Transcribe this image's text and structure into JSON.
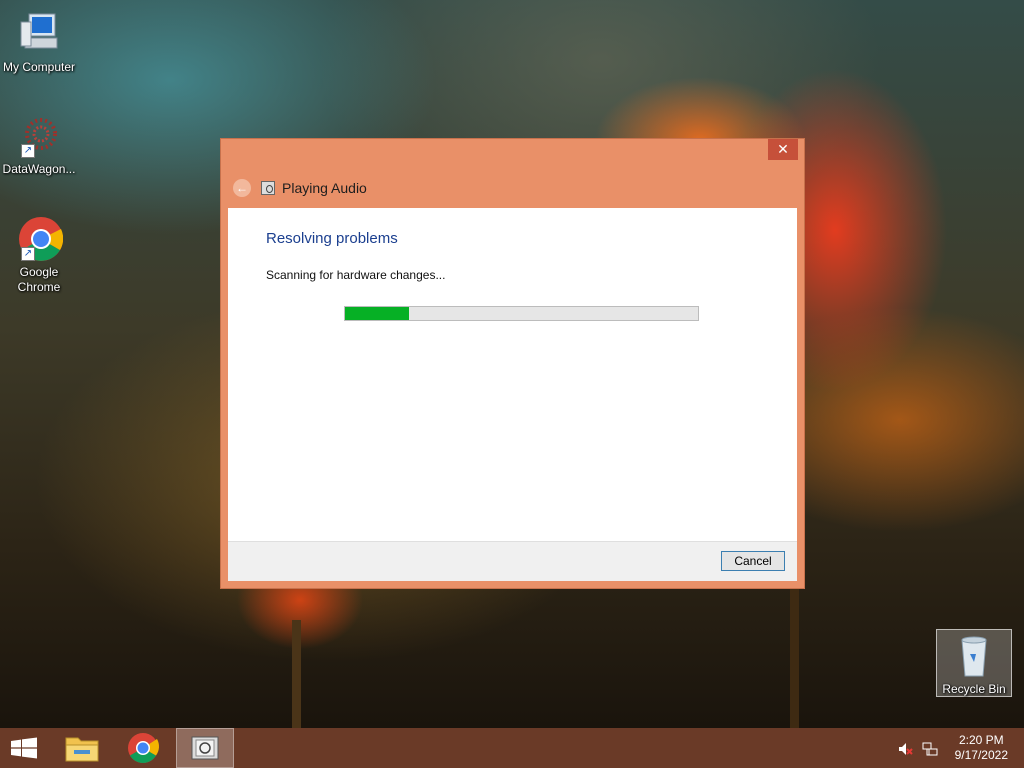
{
  "desktop": {
    "icons": [
      {
        "label": "My Computer",
        "icon": "my-computer-icon"
      },
      {
        "label": "DataWagon...",
        "icon": "datawagon-icon"
      },
      {
        "label": "Google Chrome",
        "icon": "chrome-icon"
      },
      {
        "label": "Recycle Bin",
        "icon": "recycle-bin-icon"
      }
    ]
  },
  "dialog": {
    "title": "Playing Audio",
    "close_symbol": "✕",
    "back_symbol": "←",
    "heading": "Resolving problems",
    "status": "Scanning for hardware changes...",
    "progress_percent": 18,
    "cancel_label": "Cancel",
    "accent_color": "#e99068"
  },
  "taskbar": {
    "items": [
      "start-button",
      "file-explorer",
      "chrome",
      "troubleshooter"
    ],
    "time": "2:20 PM",
    "date": "9/17/2022"
  }
}
